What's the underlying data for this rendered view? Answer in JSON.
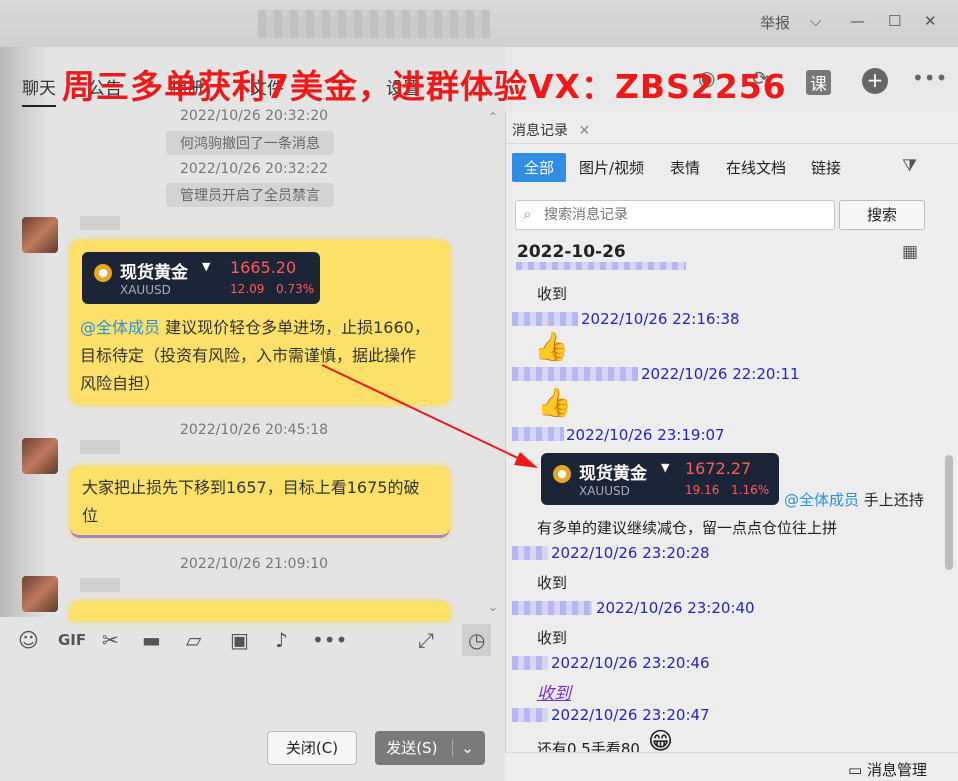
{
  "window": {
    "report_label": "举报",
    "controls": [
      "chevron-down-icon",
      "minimize-icon",
      "maximize-icon",
      "close-icon"
    ]
  },
  "overlay_text": "周三多单获利7美金，进群体验VX：ZBS2256",
  "tabs": [
    {
      "label": "聊天"
    },
    {
      "label": "公告"
    },
    {
      "label": "相册"
    },
    {
      "label": "文件"
    },
    {
      "label": "设置"
    }
  ],
  "header_icons": {
    "course_label": "课"
  },
  "chat": {
    "sys1_time": "2022/10/26 20:32:20",
    "sys1_msg": "何鸿驹撤回了一条消息",
    "sys2_time": "2022/10/26 20:32:22",
    "sys2_msg": "管理员开启了全员禁言",
    "card1": {
      "name": "现货黄金",
      "symbol": "XAUUSD",
      "price": "1665.20",
      "change": "12.09",
      "pct": "0.73%"
    },
    "msg1_at": "@全体成员",
    "msg1_line1": " 建议现价轻仓多单进场，止损1660，",
    "msg1_line2": "目标待定（投资有风险，入市需谨慎，据此操作",
    "msg1_line3": "风险自担）",
    "time2": "2022/10/26 20:45:18",
    "msg2_line1": "大家把止损先下移到1657，目标上看1675的破",
    "msg2_line2": "位",
    "time3": "2022/10/26 21:09:10"
  },
  "buttons": {
    "close": "关闭(C)",
    "send": "发送(S)"
  },
  "history": {
    "tab_label": "消息记录",
    "filters": [
      "全部",
      "图片/视频",
      "表情",
      "在线文档",
      "链接"
    ],
    "search_placeholder": "搜索消息记录",
    "search_button": "搜索",
    "date": "2022-10-26",
    "items": [
      {
        "text": "收到"
      },
      {
        "time": "2022/10/26 22:16:38"
      },
      {
        "time": "2022/10/26 22:20:11"
      },
      {
        "time": "2022/10/26 23:19:07"
      },
      {
        "time": "2022/10/26 23:20:28"
      },
      {
        "text": "收到"
      },
      {
        "time": "2022/10/26 23:20:40"
      },
      {
        "text": "收到"
      },
      {
        "time": "2022/10/26 23:20:46"
      },
      {
        "text": "收到"
      },
      {
        "time": "2022/10/26 23:20:47"
      },
      {
        "text": "还有0.5手看80"
      }
    ],
    "card2": {
      "name": "现货黄金",
      "symbol": "XAUUSD",
      "price": "1672.27",
      "change": "19.16",
      "pct": "1.16%"
    },
    "card2_at": "@全体成员",
    "card2_after": " 手上还持",
    "card2_line2": "有多单的建议继续减仓，留一点点仓位往上拼",
    "manage_label": "消息管理"
  }
}
